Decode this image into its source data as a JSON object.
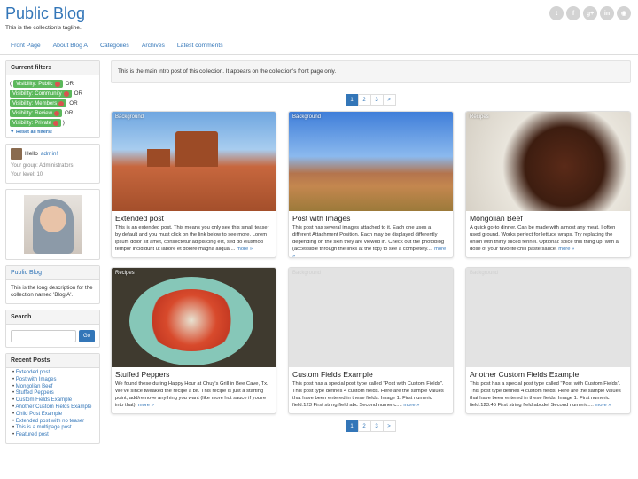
{
  "site": {
    "title": "Public Blog",
    "tagline": "This is the collection's tagline."
  },
  "social": [
    "twitter-icon",
    "facebook-icon",
    "googleplus-icon",
    "linkedin-icon",
    "github-icon"
  ],
  "nav": [
    "Front Page",
    "About Blog A",
    "Categories",
    "Archives",
    "Latest comments"
  ],
  "filters": {
    "heading": "Current filters",
    "items": [
      {
        "label": "Visibility:",
        "value": "Public"
      },
      {
        "label": "Visibility:",
        "value": "Community"
      },
      {
        "label": "Visibility:",
        "value": "Members"
      },
      {
        "label": "Visibility:",
        "value": "Review"
      },
      {
        "label": "Visibility:",
        "value": "Private"
      }
    ],
    "or": "OR",
    "open_paren": "(",
    "close_paren": ")",
    "reset": "Reset all filters!"
  },
  "user": {
    "hello": "Hello",
    "name": "admin!",
    "group": "Your group: Administrators",
    "level": "Your level: 10"
  },
  "blog_info": {
    "title": "Public Blog",
    "description": "This is the long description for the collection named 'Blog A'."
  },
  "search": {
    "heading": "Search",
    "button": "Go"
  },
  "recent": {
    "heading": "Recent Posts",
    "items": [
      "Extended post",
      "Post with Images",
      "Mongolian Beef",
      "Stuffed Peppers",
      "Custom Fields Example",
      "Another Custom Fields Example",
      "Child Post Example",
      "Extended post with no teaser",
      "This is a multipage post",
      "Featured post"
    ]
  },
  "intro": "This is the main intro post of this collection. It appears on the collection's front page only.",
  "pager": [
    "1",
    "2",
    "3",
    ">"
  ],
  "posts": [
    {
      "category": "Background",
      "title": "Extended post",
      "text": "This is an extended post. This means you only see this small teaser by default and you must click on the link below to see more. Lorem ipsum dolor sit amet, consectetur adipisicing elit, sed do eiusmod tempor incididunt ut labore et dolore magna aliqua....",
      "more": "more »"
    },
    {
      "category": "Background",
      "title": "Post with Images",
      "text": "This post has several images attached to it. Each one uses a different Attachment Position. Each may be displayed differently depending on the skin they are viewed in. Check out the photoblog (accessible through the links at the top) to see a completely....",
      "more": "more »"
    },
    {
      "category": "Recipes",
      "title": "Mongolian Beef",
      "text": "A quick go-to dinner. Can be made with almost any meat. I often used ground. Works perfect for lettuce wraps. Try replacing the onion with thinly sliced fennel. Optional: spice this thing up, with a dose of your favorite chili paste/sauce.",
      "more": "more »"
    },
    {
      "category": "Recipes",
      "title": "Stuffed Peppers",
      "text": "We found these during Happy Hour at Chuy's Grill in Bee Cave, Tx. We've since tweaked the recipe a bit. This recipe is just a starting point, add/remove anything you want (like more hot sauce if you're into that).",
      "more": "more »"
    },
    {
      "category": "Background",
      "title": "Custom Fields Example",
      "text": "This post has a special post type called \"Post with Custom Fields\". This post type defines 4 custom fields. Here are the sample values that have been entered in these fields: Image 1: First numeric field:123 First string field abc Second numeric....",
      "more": "more »"
    },
    {
      "category": "Background",
      "title": "Another Custom Fields Example",
      "text": "This post has a special post type called \"Post with Custom Fields\". This post type defines 4 custom fields. Here are the sample values that have been entered in these fields: Image 1: First numeric field:123.45 First string field abcdef Second numeric....",
      "more": "more »"
    }
  ]
}
